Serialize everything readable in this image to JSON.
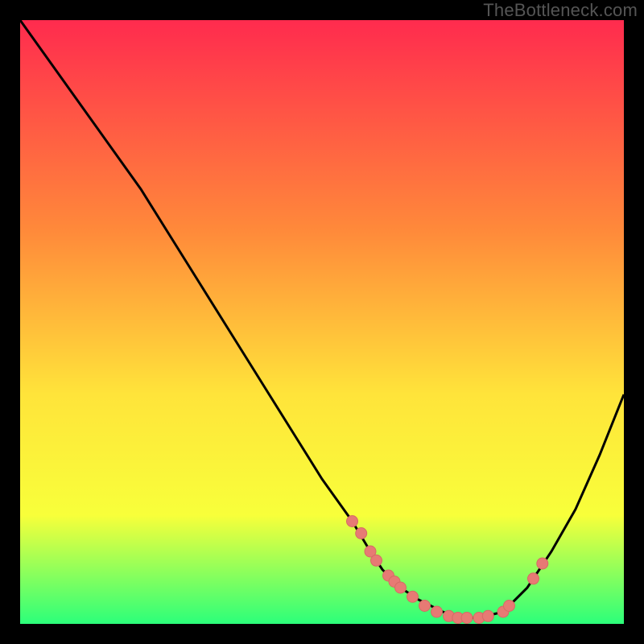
{
  "watermark": "TheBottleneck.com",
  "colors": {
    "bg": "#000000",
    "gradient_top": "#ff2b4e",
    "gradient_mid1": "#ff8a3a",
    "gradient_mid2": "#ffe43a",
    "gradient_mid3": "#f8ff3a",
    "gradient_bottom": "#2cff7a",
    "curve": "#000000",
    "marker_fill": "#e77a74",
    "marker_stroke": "#d66a64"
  },
  "chart_data": {
    "type": "line",
    "title": "",
    "xlabel": "",
    "ylabel": "",
    "xlim": [
      0,
      100
    ],
    "ylim": [
      0,
      100
    ],
    "series": [
      {
        "name": "curve",
        "x": [
          0,
          5,
          10,
          15,
          20,
          25,
          30,
          35,
          40,
          45,
          50,
          55,
          58,
          60,
          63,
          66,
          70,
          73,
          76,
          80,
          84,
          88,
          92,
          96,
          100
        ],
        "y": [
          100,
          93,
          86,
          79,
          72,
          64,
          56,
          48,
          40,
          32,
          24,
          17,
          12,
          9,
          6,
          4,
          2,
          1,
          1,
          2,
          6,
          12,
          19,
          28,
          38
        ]
      }
    ],
    "markers": [
      {
        "x": 55,
        "y": 17
      },
      {
        "x": 56.5,
        "y": 15
      },
      {
        "x": 58,
        "y": 12
      },
      {
        "x": 59,
        "y": 10.5
      },
      {
        "x": 61,
        "y": 8
      },
      {
        "x": 62,
        "y": 7
      },
      {
        "x": 63,
        "y": 6
      },
      {
        "x": 65,
        "y": 4.5
      },
      {
        "x": 67,
        "y": 3
      },
      {
        "x": 69,
        "y": 2
      },
      {
        "x": 71,
        "y": 1.3
      },
      {
        "x": 72.5,
        "y": 1
      },
      {
        "x": 74,
        "y": 1
      },
      {
        "x": 76,
        "y": 1
      },
      {
        "x": 77.5,
        "y": 1.3
      },
      {
        "x": 80,
        "y": 2
      },
      {
        "x": 81,
        "y": 3
      },
      {
        "x": 85,
        "y": 7.5
      },
      {
        "x": 86.5,
        "y": 10
      }
    ]
  }
}
